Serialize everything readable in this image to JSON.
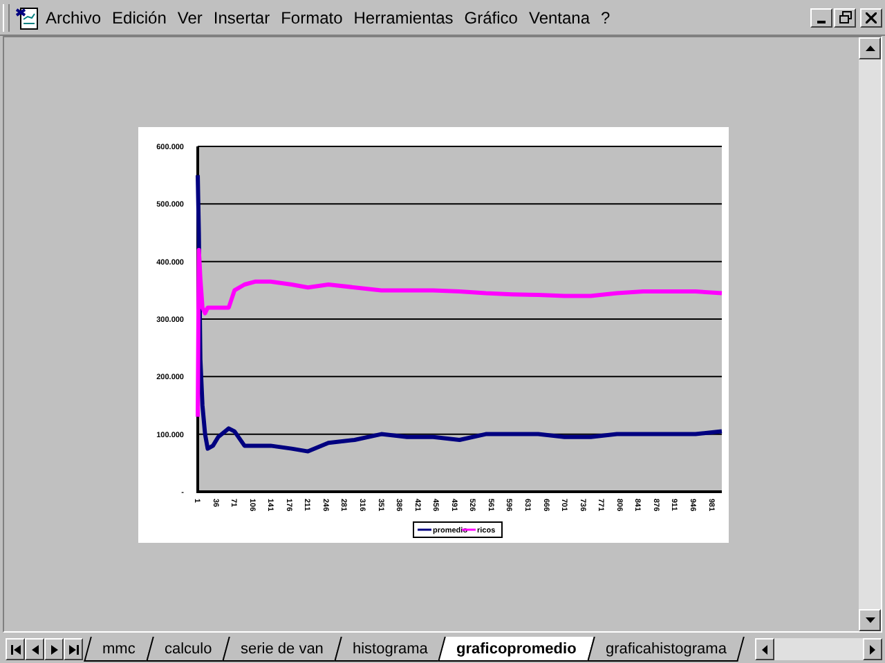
{
  "menu": [
    {
      "label": "Archivo"
    },
    {
      "label": "Edición"
    },
    {
      "label": "Ver"
    },
    {
      "label": "Insertar"
    },
    {
      "label": "Formato"
    },
    {
      "label": "Herramientas"
    },
    {
      "label": "Gráfico"
    },
    {
      "label": "Ventana"
    },
    {
      "label": "?"
    }
  ],
  "chart": {
    "chart_data": {
      "type": "line",
      "x": [
        1,
        3,
        6,
        10,
        15,
        20,
        30,
        40,
        60,
        71,
        90,
        110,
        140,
        180,
        211,
        250,
        300,
        351,
        400,
        450,
        500,
        550,
        600,
        650,
        700,
        750,
        800,
        850,
        900,
        950,
        1000
      ],
      "series": [
        {
          "name": "promedio",
          "color": "#000080",
          "values": [
            550000,
            450000,
            230000,
            150000,
            100000,
            75000,
            80000,
            95000,
            110000,
            105000,
            80000,
            80000,
            80000,
            75000,
            70000,
            85000,
            90000,
            100000,
            95000,
            95000,
            90000,
            100000,
            100000,
            100000,
            95000,
            95000,
            100000,
            100000,
            100000,
            100000,
            105000
          ]
        },
        {
          "name": "ricos",
          "color": "#ff00ff",
          "values": [
            130000,
            420000,
            370000,
            320000,
            310000,
            320000,
            320000,
            320000,
            320000,
            350000,
            360000,
            365000,
            365000,
            360000,
            355000,
            360000,
            355000,
            350000,
            350000,
            350000,
            348000,
            345000,
            343000,
            342000,
            340000,
            340000,
            345000,
            348000,
            348000,
            348000,
            345000
          ]
        }
      ],
      "grid": "y",
      "legend": "bottom",
      "xlim": [
        1,
        1000
      ],
      "ylim": [
        0,
        600000
      ],
      "xticks": [
        1,
        36,
        71,
        106,
        141,
        176,
        211,
        246,
        281,
        316,
        351,
        386,
        421,
        456,
        491,
        526,
        561,
        596,
        631,
        666,
        701,
        736,
        771,
        806,
        841,
        876,
        911,
        946,
        981
      ],
      "yticks": [
        {
          "value": 0,
          "label": "-"
        },
        {
          "value": 100000,
          "label": "100.000"
        },
        {
          "value": 200000,
          "label": "200.000"
        },
        {
          "value": 300000,
          "label": "300.000"
        },
        {
          "value": 400000,
          "label": "400.000"
        },
        {
          "value": 500000,
          "label": "500.000"
        },
        {
          "value": 600000,
          "label": "600.000"
        }
      ]
    }
  },
  "sheet_tabs": [
    {
      "label": "mmc",
      "selected": false
    },
    {
      "label": "calculo",
      "selected": false
    },
    {
      "label": "serie de van",
      "selected": false
    },
    {
      "label": "histograma",
      "selected": false
    },
    {
      "label": "graficopromedio",
      "selected": true
    },
    {
      "label": "graficahistograma",
      "selected": false
    }
  ]
}
